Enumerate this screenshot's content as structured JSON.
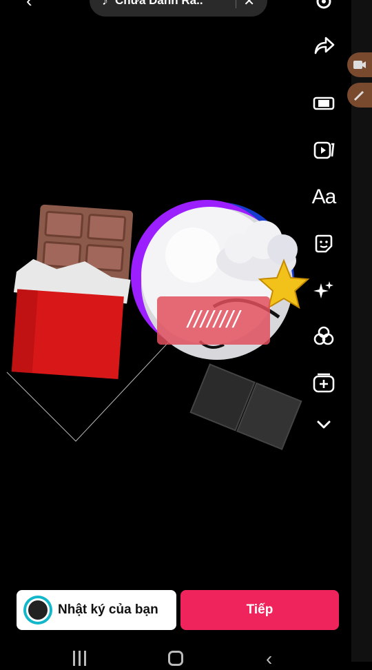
{
  "top": {
    "music_title": "Chưa Dành Ra..",
    "music_icon": "music-note-icon",
    "close_icon": "close-icon",
    "back_icon": "chevron-left-icon"
  },
  "toolbar": {
    "items": [
      {
        "name": "settings",
        "icon": "gear-icon"
      },
      {
        "name": "share",
        "icon": "share-arrow-icon"
      },
      {
        "name": "templates",
        "icon": "phone-frame-icon"
      },
      {
        "name": "video",
        "icon": "video-clip-icon"
      },
      {
        "name": "text",
        "label": "Aa"
      },
      {
        "name": "sticker",
        "icon": "sticker-icon"
      },
      {
        "name": "effects",
        "icon": "sparkles-icon"
      },
      {
        "name": "filters",
        "icon": "filters-icon"
      },
      {
        "name": "add",
        "icon": "add-clip-icon"
      },
      {
        "name": "more",
        "icon": "chevron-down-icon"
      }
    ]
  },
  "canvas": {
    "censor_text": "////////"
  },
  "actions": {
    "diary_label": "Nhật ký của bạn",
    "next_label": "Tiếp"
  },
  "colors": {
    "next_button": "#f0245c",
    "diary_button": "#ffffff",
    "chocolate_wrapper": "#d81818",
    "chocolate": "#8b5a4a",
    "face_glow": "#9b1fff"
  }
}
